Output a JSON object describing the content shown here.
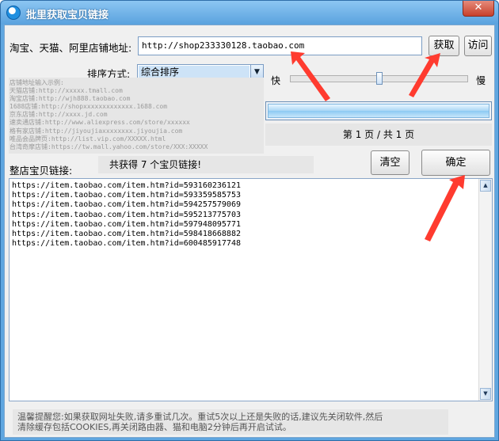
{
  "window": {
    "title": "批里获取宝贝链接",
    "close": "✕"
  },
  "shop": {
    "url_label": "淘宝、天猫、阿里店铺地址:",
    "url_value": "http://shop233330128.taobao.com",
    "fetch_label": "获取",
    "visit_label": "访问"
  },
  "sort": {
    "label": "排序方式:",
    "selected": "综合排序"
  },
  "speed": {
    "fast_label": "快",
    "slow_label": "慢",
    "level": 0.5
  },
  "examples": [
    "店铺地址输入示例:",
    "天猫店铺:http://xxxxx.tmall.com",
    "淘宝店铺:http://wjh888.taobao.com",
    "1688店铺:http://shopxxxxxxxxxxxxx.1688.com",
    "京东店铺:http://xxxx.jd.com",
    "速卖通店铺:http://www.aliexpress.com/store/xxxxxx",
    "格有家店铺:http://jiyoujiaxxxxxxxx.jiyoujia.com",
    "唯品会品牌页:http://list.vip.com/XXXXX.html",
    "台湾奇摩店铺:https://tw.mall.yahoo.com/store/XXX:XXXXX"
  ],
  "progress": {
    "value": 1.0
  },
  "pagination": {
    "text": "第 1 页 / 共 1 页"
  },
  "result": {
    "label": "整店宝贝链接:",
    "status": "共获得 7 个宝贝链接!",
    "clear_label": "清空",
    "confirm_label": "确定",
    "links": [
      "https://item.taobao.com/item.htm?id=593160236121",
      "https://item.taobao.com/item.htm?id=593359585753",
      "https://item.taobao.com/item.htm?id=594257579069",
      "https://item.taobao.com/item.htm?id=595213775703",
      "https://item.taobao.com/item.htm?id=597948095771",
      "https://item.taobao.com/item.htm?id=598418668882",
      "https://item.taobao.com/item.htm?id=600485917748"
    ]
  },
  "tip": {
    "line1": "温馨提醒您:如果获取网址失败,请多重试几次。重试5次以上还是失败的话,建议先关闭软件,然后",
    "line2": "清除缓存包括COOKIES,再关闭路由器、猫和电脑2分钟后再开启试试。"
  },
  "colors": {
    "title_bar": "#5aa2de",
    "arrow": "#ff3b2f",
    "selection": "#cde3f7"
  }
}
